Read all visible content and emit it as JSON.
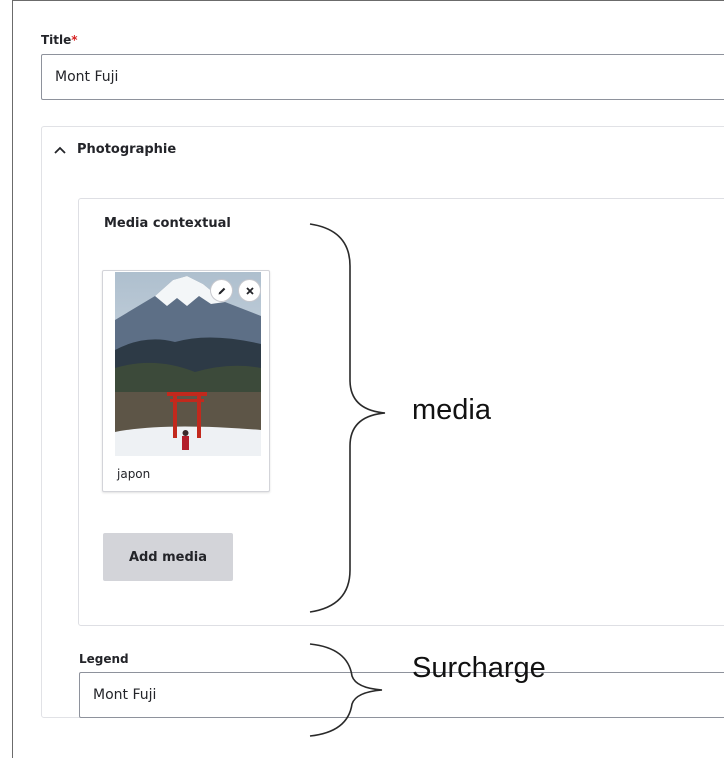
{
  "title_field": {
    "label": "Title",
    "required_mark": "*",
    "value": "Mont Fuji"
  },
  "section": {
    "label": "Photographie",
    "expanded": true
  },
  "media_widget": {
    "label": "Media contextual",
    "items": [
      {
        "name": "japon",
        "edit_icon": "pencil-icon",
        "remove_icon": "close-icon"
      }
    ],
    "add_button": "Add media"
  },
  "legend_field": {
    "label": "Legend",
    "value": "Mont Fuji"
  },
  "annotations": {
    "media": "media",
    "override": "Surcharge"
  },
  "colors": {
    "required": "#d72222",
    "button_bg": "#d3d4d9",
    "border": "#8e929c"
  }
}
